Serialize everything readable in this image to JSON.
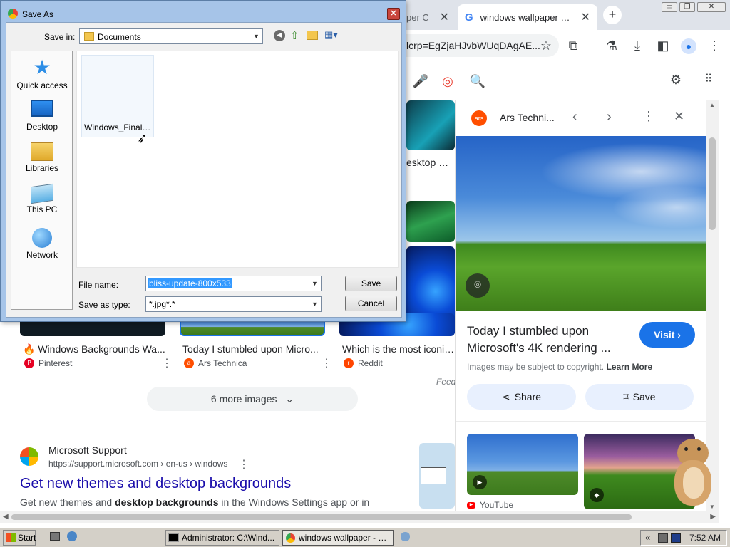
{
  "browser": {
    "tabs": [
      {
        "label": "per C",
        "close": "✕"
      },
      {
        "label": "windows wallpaper - Go",
        "close": "✕"
      }
    ],
    "new_tab": "+",
    "window_buttons": [
      "▭",
      "❐",
      "✕"
    ],
    "url": "lcrp=EgZjaHJvbWUqDAgAE..."
  },
  "results": {
    "cards": [
      {
        "title": "Windows Backgrounds Wa...",
        "source": "Pinterest",
        "emoji": "🔥"
      },
      {
        "title": "Today I stumbled upon Micro...",
        "source": "Ars Technica"
      },
      {
        "title": "Which is the most iconic o",
        "source": "Reddit"
      }
    ],
    "snippet_left": "esktop — G",
    "feedback": "Feed",
    "more_images": "6 more images",
    "result": {
      "site": "Microsoft Support",
      "breadcrumb": "https://support.microsoft.com › en-us › windows",
      "title": "Get new themes and desktop backgrounds",
      "snippet_pre": "Get new themes and ",
      "snippet_bold": "desktop backgrounds",
      "snippet_post": " in the Windows Settings app or in"
    }
  },
  "panel": {
    "source": "Ars Techni...",
    "title_line1": "Today I stumbled upon",
    "title_line2": "Microsoft's 4K rendering ...",
    "visit": "Visit",
    "copyright": "Images may be subject to copyright.",
    "learn_more": "Learn More",
    "share": "Share",
    "save": "Save",
    "related_source": "YouTube"
  },
  "dialog": {
    "title": "Save As",
    "save_in_label": "Save in:",
    "save_in_value": "Documents",
    "places": [
      "Quick access",
      "Desktop",
      "Libraries",
      "This PC",
      "Network"
    ],
    "file_item": "Windows_Final_...",
    "file_name_label": "File name:",
    "file_name_value": "bliss-update-800x533",
    "type_label": "Save as type:",
    "type_value": "*.jpg*.*",
    "save_button": "Save",
    "cancel_button": "Cancel"
  },
  "taskbar": {
    "start": "Start",
    "items": [
      "Administrator: C:\\Wind...",
      "windows wallpaper - G..."
    ],
    "tray_arrow": "«",
    "clock": "7:52 AM"
  },
  "colors": {
    "accent": "#1a73e8",
    "link": "#1a0dab",
    "selection": "#3399ff"
  }
}
